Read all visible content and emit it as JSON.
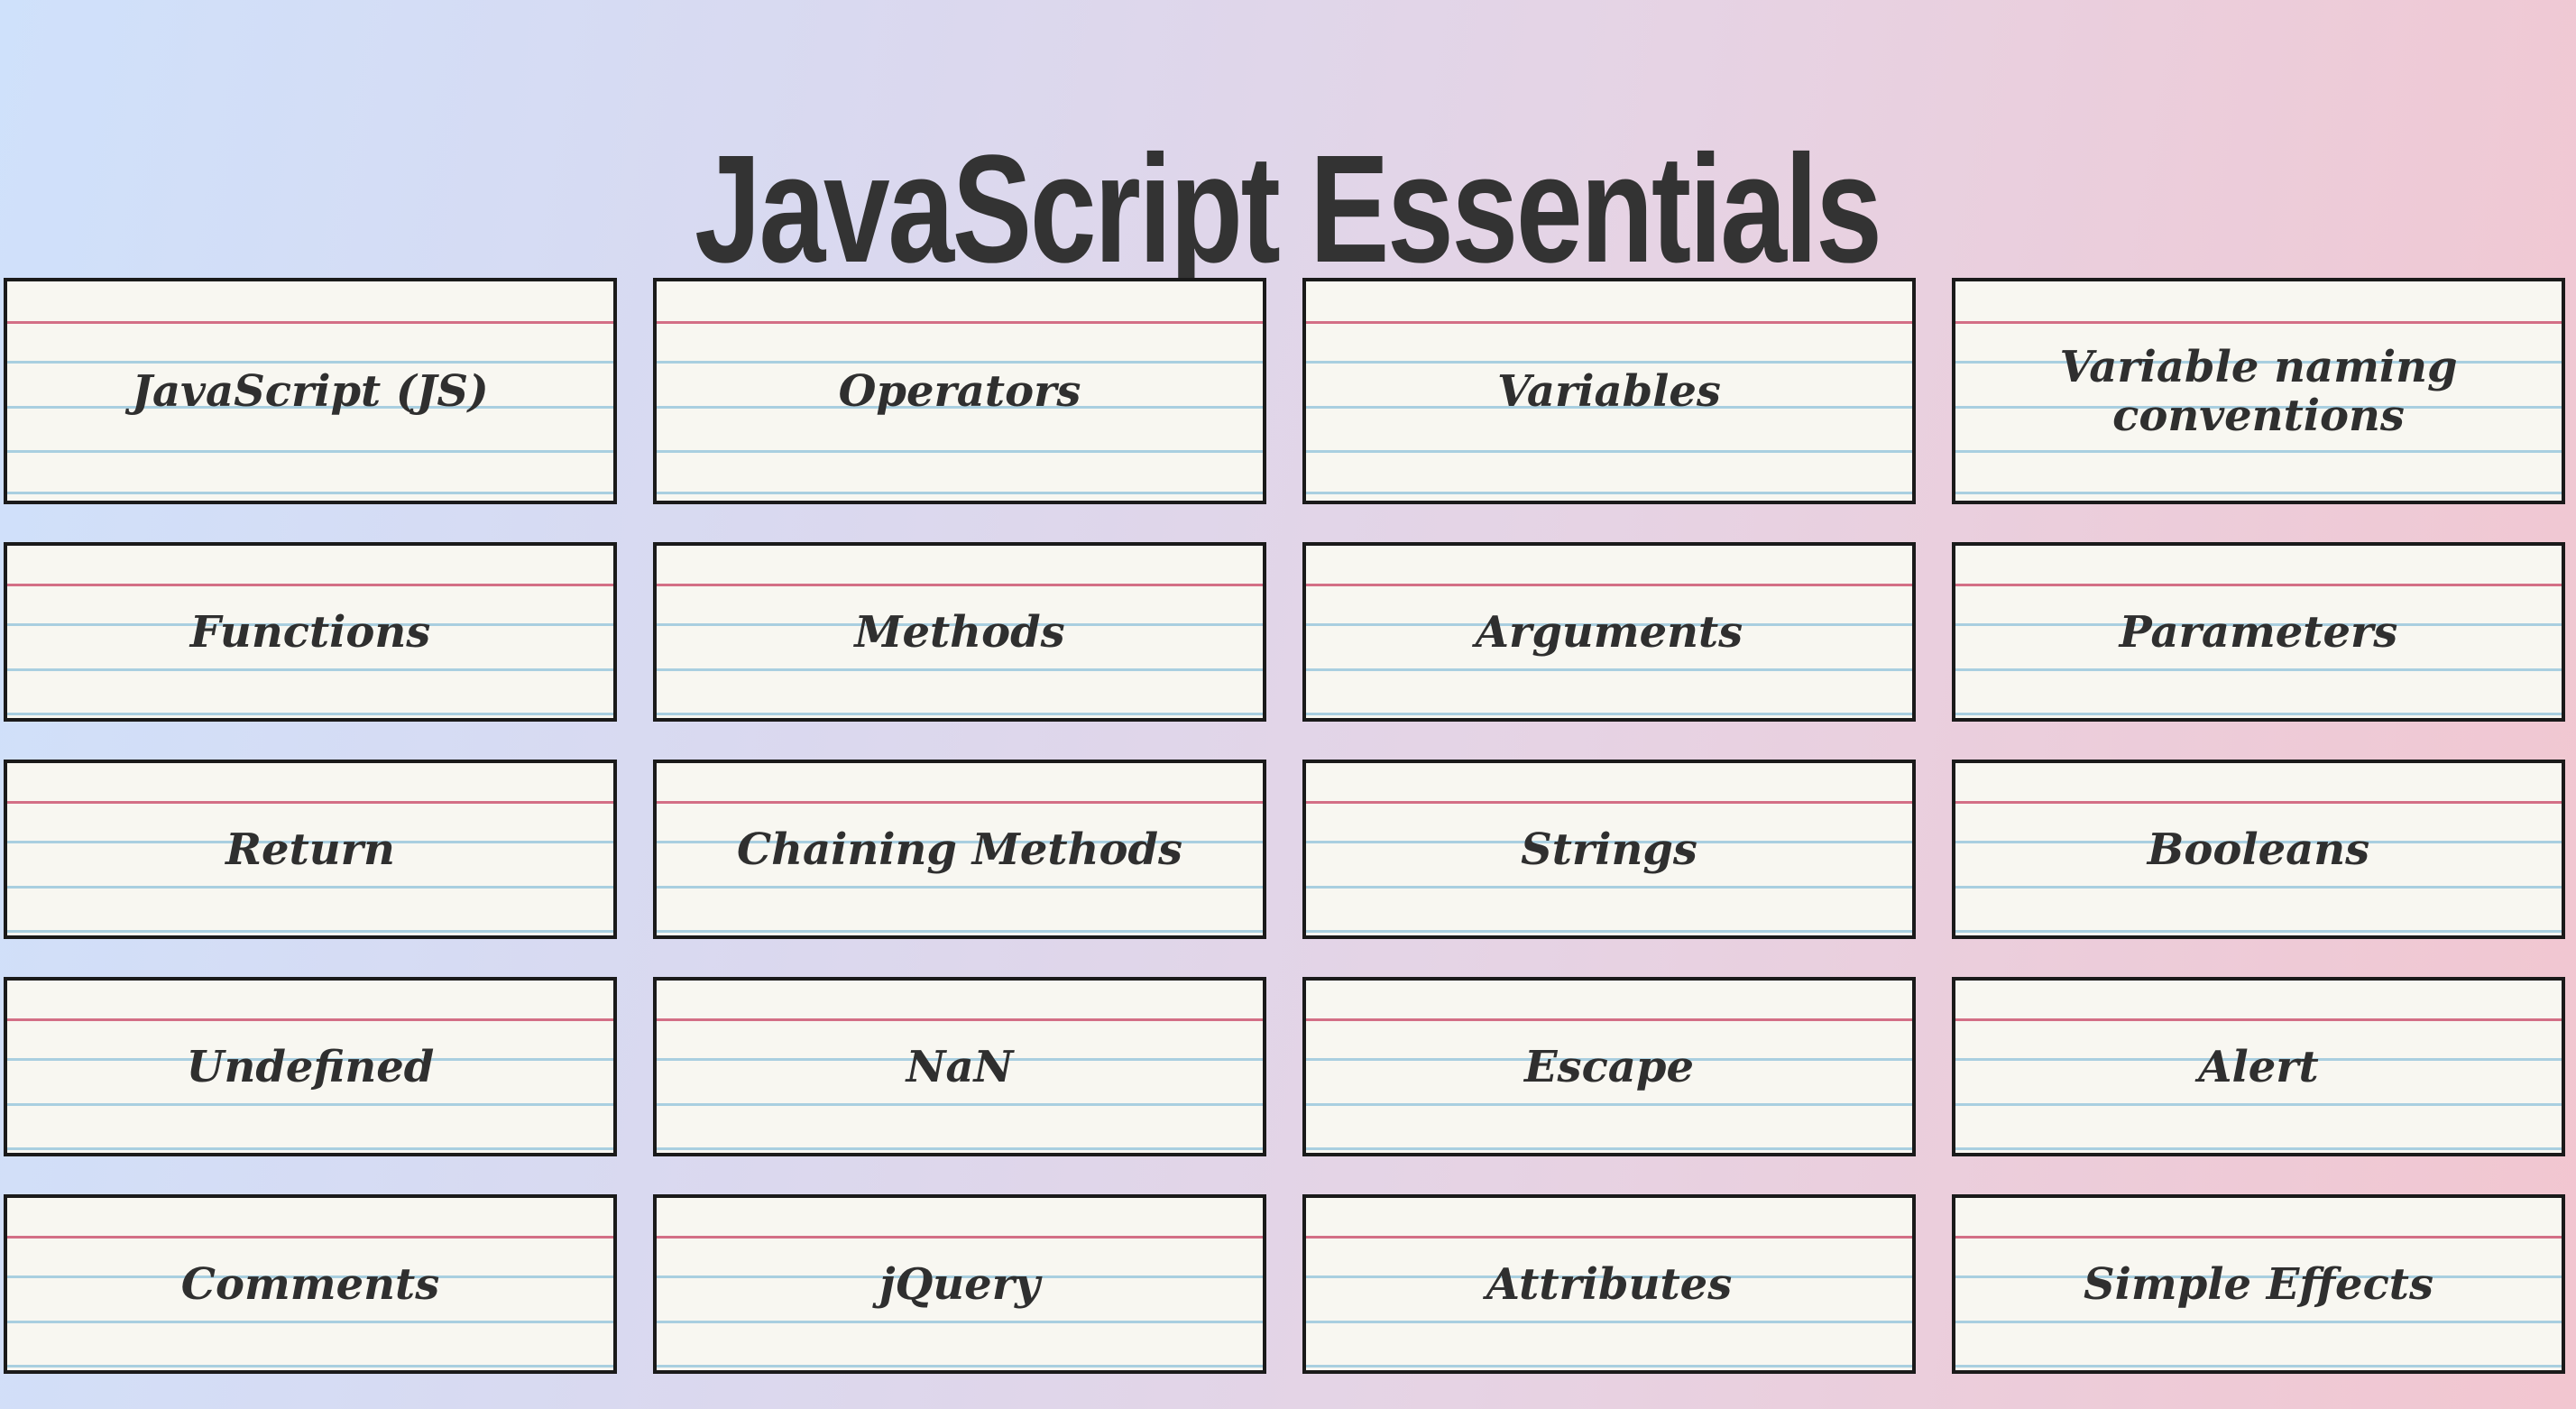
{
  "title": "JavaScript Essentials",
  "cards": [
    {
      "label": "JavaScript (JS)"
    },
    {
      "label": "Operators"
    },
    {
      "label": "Variables"
    },
    {
      "label": "Variable naming conventions"
    },
    {
      "label": "Functions"
    },
    {
      "label": "Methods"
    },
    {
      "label": "Arguments"
    },
    {
      "label": "Parameters"
    },
    {
      "label": "Return"
    },
    {
      "label": "Chaining Methods"
    },
    {
      "label": "Strings"
    },
    {
      "label": "Booleans"
    },
    {
      "label": "Undefined"
    },
    {
      "label": "NaN"
    },
    {
      "label": "Escape"
    },
    {
      "label": "Alert"
    },
    {
      "label": "Comments"
    },
    {
      "label": "jQuery"
    },
    {
      "label": "Attributes"
    },
    {
      "label": "Simple Effects"
    }
  ],
  "colors": {
    "background_left": "#cfe1fb",
    "background_right": "#f2c6d0",
    "title": "#333333",
    "card_paper": "#f8f7f1",
    "card_border": "#1a1a1a",
    "red_rule": "#d36f86",
    "blue_rule": "#a9cfe0"
  }
}
